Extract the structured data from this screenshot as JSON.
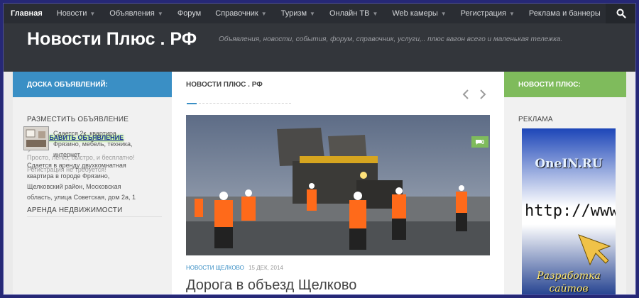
{
  "nav": {
    "items": [
      {
        "label": "Главная",
        "active": true,
        "dropdown": false
      },
      {
        "label": "Новости",
        "active": false,
        "dropdown": true
      },
      {
        "label": "Объявления",
        "active": false,
        "dropdown": true
      },
      {
        "label": "Форум",
        "active": false,
        "dropdown": false
      },
      {
        "label": "Справочник",
        "active": false,
        "dropdown": true
      },
      {
        "label": "Туризм",
        "active": false,
        "dropdown": true
      },
      {
        "label": "Онлайн ТВ",
        "active": false,
        "dropdown": true
      },
      {
        "label": "Web камеры",
        "active": false,
        "dropdown": true
      },
      {
        "label": "Регистрация",
        "active": false,
        "dropdown": true
      },
      {
        "label": "Реклама и баннеры",
        "active": false,
        "dropdown": false
      }
    ],
    "search_icon": "search-icon"
  },
  "header": {
    "title": "Новости Плюс . РФ",
    "tagline": "Объявления, новости, события, форум, справочник, услуги,.. плюс вагон всего и маленькая тележка."
  },
  "left": {
    "heading": "ДОСКА ОБЪЯВЛЕНИЙ:",
    "post_title": "РАЗМЕСТИТЬ ОБЪЯВЛЕНИЕ",
    "add_button": "ДОБАВИТЬ ОБЪЯВЛЕНИЕ",
    "add_text_1": "Просто, легко, быстро, и бесплатно!",
    "add_text_2": "Регистрация не требуется!",
    "rent_title": "АРЕНДА НЕДВИЖИМОСТИ",
    "listing_title_1": "Сдается 2к. квартира",
    "listing_title_2": "Фрязино, мебель, техника,",
    "listing_title_3": "интернет",
    "listing_desc_1": "Сдается в аренду двухкомнатная",
    "listing_desc_2": "квартира в городе Фрязино,",
    "listing_desc_3": "Щелковский район, Московская",
    "listing_desc_4": "область, улица Советская, дом 2а, 1"
  },
  "middle": {
    "heading": "НОВОСТИ ПЛЮС . РФ",
    "prev_icon": "chevron-left-icon",
    "next_icon": "chevron-right-icon",
    "comment_count": "0",
    "post_category": "НОВОСТИ ЩЕЛКОВО",
    "post_date": "15 ДЕК, 2014",
    "post_title": "Дорога в объезд Щелково"
  },
  "right": {
    "heading": "НОВОСТИ ПЛЮС:",
    "ad_title": "РЕКЛАМА",
    "banner_top": "OneIN.RU",
    "banner_url": "http://www.",
    "banner_bottom_1": "Разработка",
    "banner_bottom_2": "сайтов"
  },
  "colors": {
    "nav_bg": "#2a2d33",
    "header_bg": "#33363b",
    "accent_blue": "#3a8fc5",
    "accent_green": "#7fbb5c",
    "outer_border": "#262876"
  }
}
